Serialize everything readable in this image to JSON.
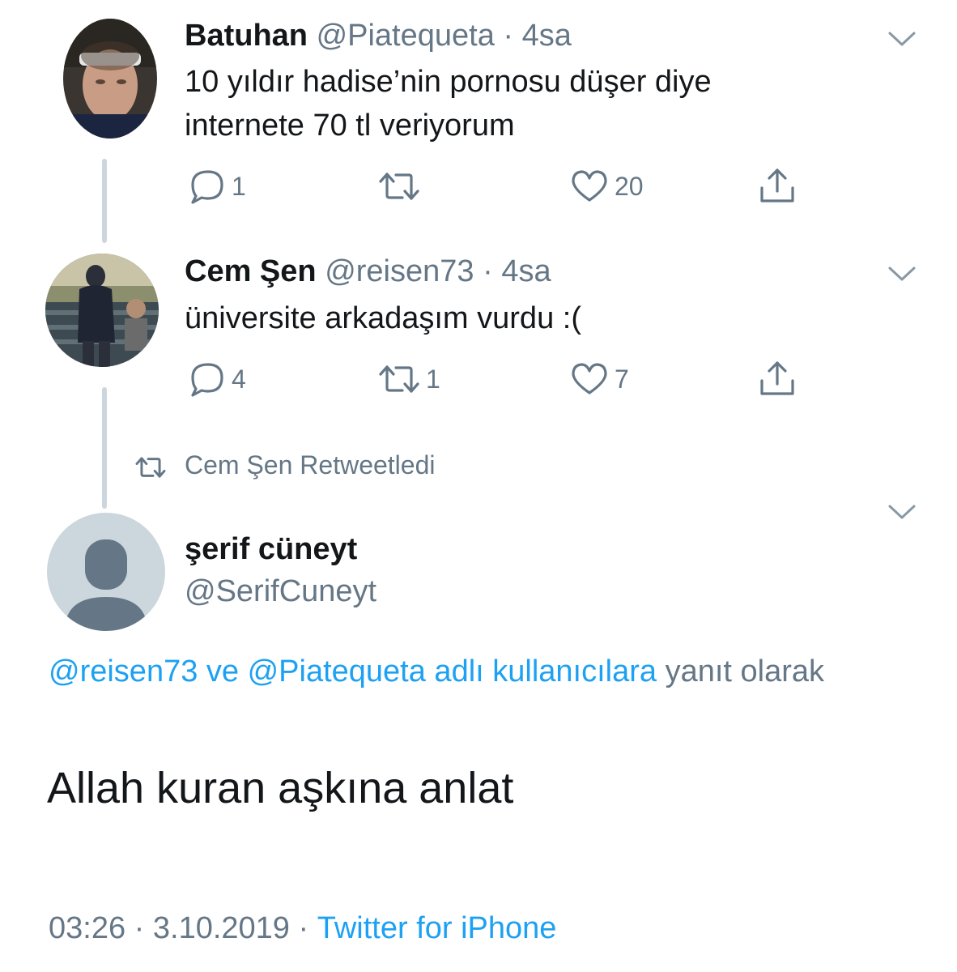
{
  "tweet1": {
    "name": "Batuhan",
    "handle": "@Piatequeta",
    "sep": "·",
    "time": "4sa",
    "text_line1": "10 yıldır hadise’nin pornosu düşer diye",
    "text_line2": "internete 70 tl veriyorum",
    "reply_count": "1",
    "retweet_count": "",
    "like_count": "20"
  },
  "tweet2": {
    "name": "Cem Şen",
    "handle": "@reisen73",
    "sep": "·",
    "time": "4sa",
    "text": "üniversite arkadaşım vurdu :(",
    "reply_count": "4",
    "retweet_count": "1",
    "like_count": "7"
  },
  "retweet_context": {
    "label": "Cem Şen Retweetledi"
  },
  "main_tweet": {
    "name": "şerif cüneyt",
    "handle": "@SerifCuneyt",
    "reply_to_prefix": "@reisen73 ve @Piatequeta adlı kullanıcılara",
    "reply_to_suffix": " yanıt olarak",
    "text": "Allah kuran aşkına anlat",
    "time": "03:26",
    "sep": "·",
    "date": "3.10.2019",
    "source": "Twitter for iPhone"
  },
  "icons": {
    "reply": "reply-icon",
    "retweet": "retweet-icon",
    "like": "heart-icon",
    "share": "share-icon",
    "caret": "chevron-down-icon"
  },
  "colors": {
    "link": "#1da1f2",
    "muted": "#657786",
    "text": "#14171a",
    "thread_line": "#ccd6dd",
    "default_avatar_bg": "#ccd6dd",
    "default_avatar_fg": "#657786"
  }
}
